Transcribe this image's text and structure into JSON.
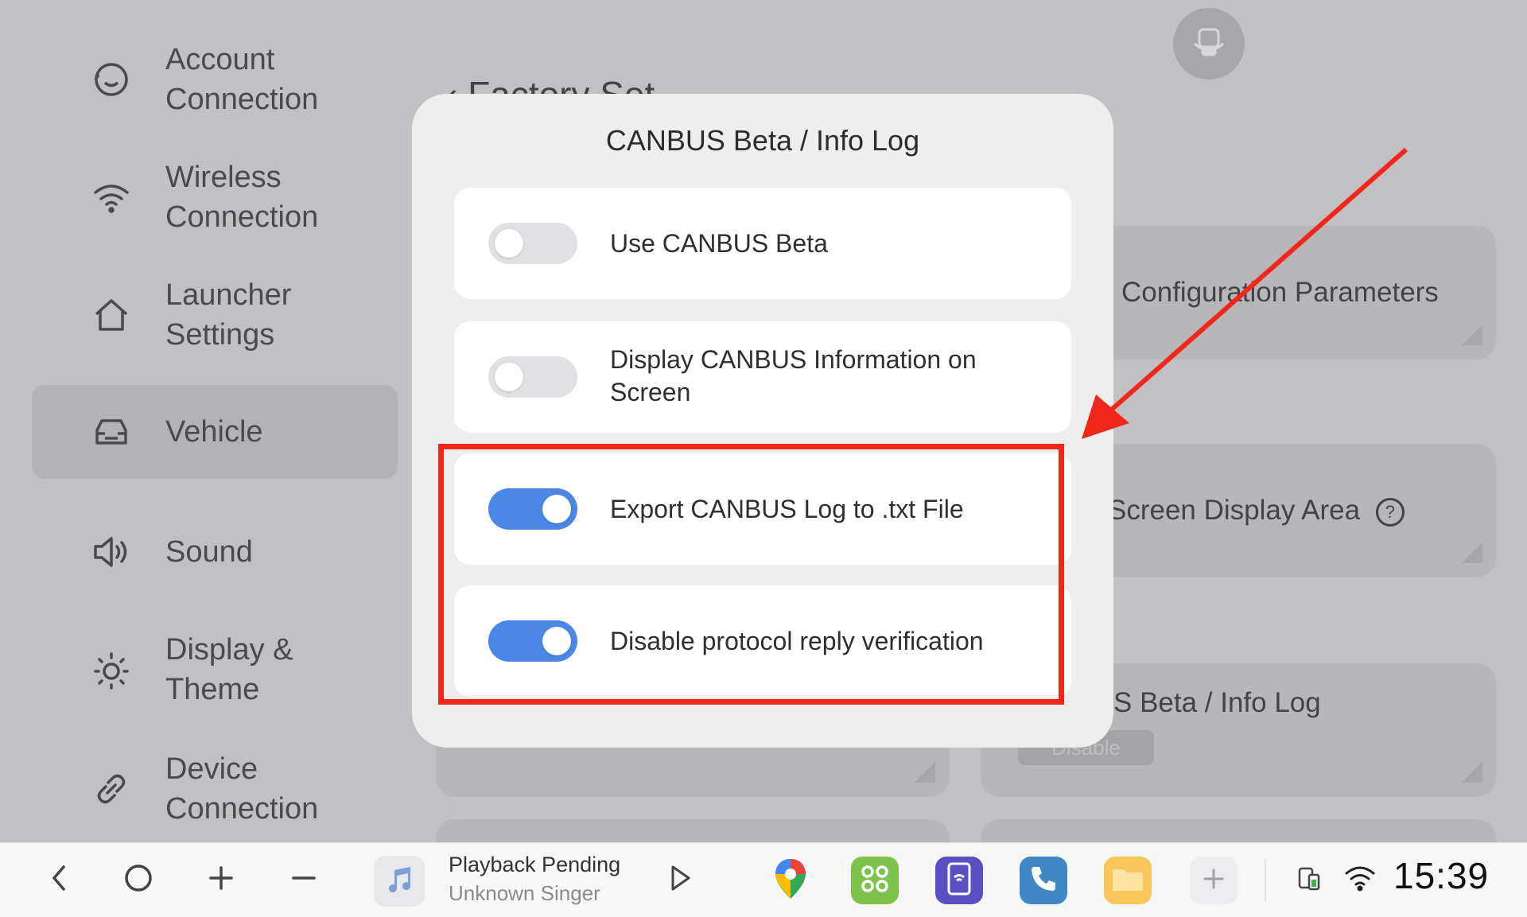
{
  "sidebar": {
    "items": [
      {
        "label_line1": "Account",
        "label_line2": "Connection",
        "icon": "account-icon"
      },
      {
        "label_line1": "Wireless",
        "label_line2": "Connection",
        "icon": "wifi-icon"
      },
      {
        "label_line1": "Launcher",
        "label_line2": "Settings",
        "icon": "home-icon"
      },
      {
        "label_line1": "Vehicle",
        "label_line2": "",
        "icon": "car-icon"
      },
      {
        "label_line1": "Sound",
        "label_line2": "",
        "icon": "speaker-icon"
      },
      {
        "label_line1": "Display &",
        "label_line2": "Theme",
        "icon": "sun-icon"
      },
      {
        "label_line1": "Device",
        "label_line2": "Connection",
        "icon": "link-icon"
      }
    ]
  },
  "background": {
    "page_title": "Factory Set",
    "card1": "Configuration Parameters",
    "card2": "Screen Display Area",
    "card3": "S Beta / Info Log",
    "card3_button": "Disable"
  },
  "dialog": {
    "title": "CANBUS Beta / Info Log",
    "options": [
      {
        "label": "Use CANBUS Beta",
        "state": "off"
      },
      {
        "label": "Display CANBUS Information on Screen",
        "state": "off"
      },
      {
        "label": "Export CANBUS Log to .txt File",
        "state": "on"
      },
      {
        "label": "Disable protocol reply verification",
        "state": "on"
      }
    ]
  },
  "taskbar": {
    "media_title": "Playback Pending",
    "media_artist": "Unknown Singer",
    "time": "15:39"
  },
  "colors": {
    "accent": "#4a87e6",
    "highlight": "#f2271a",
    "arrow": "#f2271a"
  }
}
